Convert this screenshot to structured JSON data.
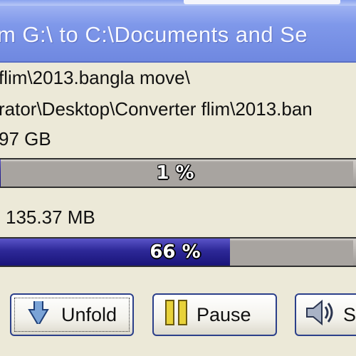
{
  "window": {
    "title": "m G:\\ to C:\\Documents and Se"
  },
  "details": {
    "source_line": "flim\\2013.bangla move\\",
    "destination_line": "rator\\Desktop\\Converter flim\\2013.ban",
    "total_size": "97 GB",
    "current_size": "135.37 MB"
  },
  "progress": {
    "total": {
      "percent": 1,
      "label": "1 %"
    },
    "current": {
      "percent": 66,
      "label": "66 %"
    }
  },
  "buttons": {
    "unfold": "Unfold",
    "pause": "Pause",
    "sound": "S"
  },
  "colors": {
    "title_bar": "#7f98ea",
    "progress_fill": "#2d2897",
    "progress_track": "#a8a4a0",
    "window_bg": "#ece9d8"
  },
  "icons": {
    "unfold": "unfold-arrow-icon",
    "pause": "pause-icon",
    "sound": "speaker-icon"
  }
}
